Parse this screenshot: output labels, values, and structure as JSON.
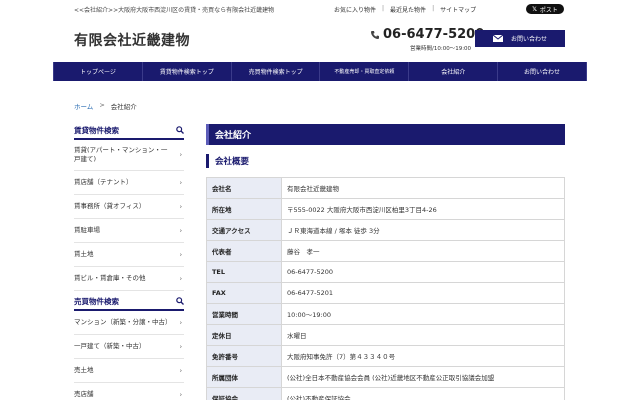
{
  "top_bar": {
    "site_description": "<<会社紹介>>大阪府大阪市西淀川区の賃貸・売買なら有限会社近畿建物",
    "links": [
      "お気に入り物件",
      "最近見た物件",
      "サイトマップ"
    ],
    "x_post_label": "ポスト"
  },
  "header": {
    "company_name": "有限会社近畿建物",
    "phone": "06-6477-5200",
    "hours": "営業時間/10:00〜19:00",
    "contact_label": "お問い合わせ"
  },
  "nav": {
    "items": [
      "トップページ",
      "賃貸物件検索トップ",
      "売買物件検索トップ",
      "不動産売却・買取査定依頼",
      "会社紹介",
      "お問い合わせ"
    ]
  },
  "breadcrumb": {
    "home": "ホーム",
    "separator": ">",
    "current": "会社紹介"
  },
  "sidebar": {
    "rental": {
      "title": "賃貸物件検索",
      "items": [
        "賃貸(アパート・マンション・一戸建て)",
        "賃店舗（テナント）",
        "賃事務所（貸オフィス）",
        "賃駐車場",
        "賃土地",
        "賃ビル・賃倉庫・その他"
      ]
    },
    "sale": {
      "title": "売買物件検索",
      "items": [
        "マンション（新築・分譲・中古）",
        "一戸建て（新築・中古）",
        "売土地",
        "売店舗"
      ]
    }
  },
  "main": {
    "page_title": "会社紹介",
    "section_title": "会社概要",
    "rows": [
      {
        "key": "会社名",
        "value": "有限会社近畿建物"
      },
      {
        "key": "所在地",
        "value": "〒555-0022 大阪府大阪市西淀川区柏里3丁目4-26"
      },
      {
        "key": "交通アクセス",
        "value": "ＪＲ東海道本線 / 塚本 徒歩 3分"
      },
      {
        "key": "代表者",
        "value": "藤谷　孝一"
      },
      {
        "key": "TEL",
        "value": "06-6477-5200"
      },
      {
        "key": "FAX",
        "value": "06-6477-5201"
      },
      {
        "key": "営業時間",
        "value": "10:00〜19:00"
      },
      {
        "key": "定休日",
        "value": "水曜日"
      },
      {
        "key": "免許番号",
        "value": "大阪府知事免許（7）第４３３４０号"
      },
      {
        "key": "所属団体",
        "value": "(公社)全日本不動産協会会員 (公社)近畿地区不動産公正取引協議会加盟"
      },
      {
        "key": "保証協会",
        "value": "(公社)不動産保証協会"
      }
    ]
  }
}
